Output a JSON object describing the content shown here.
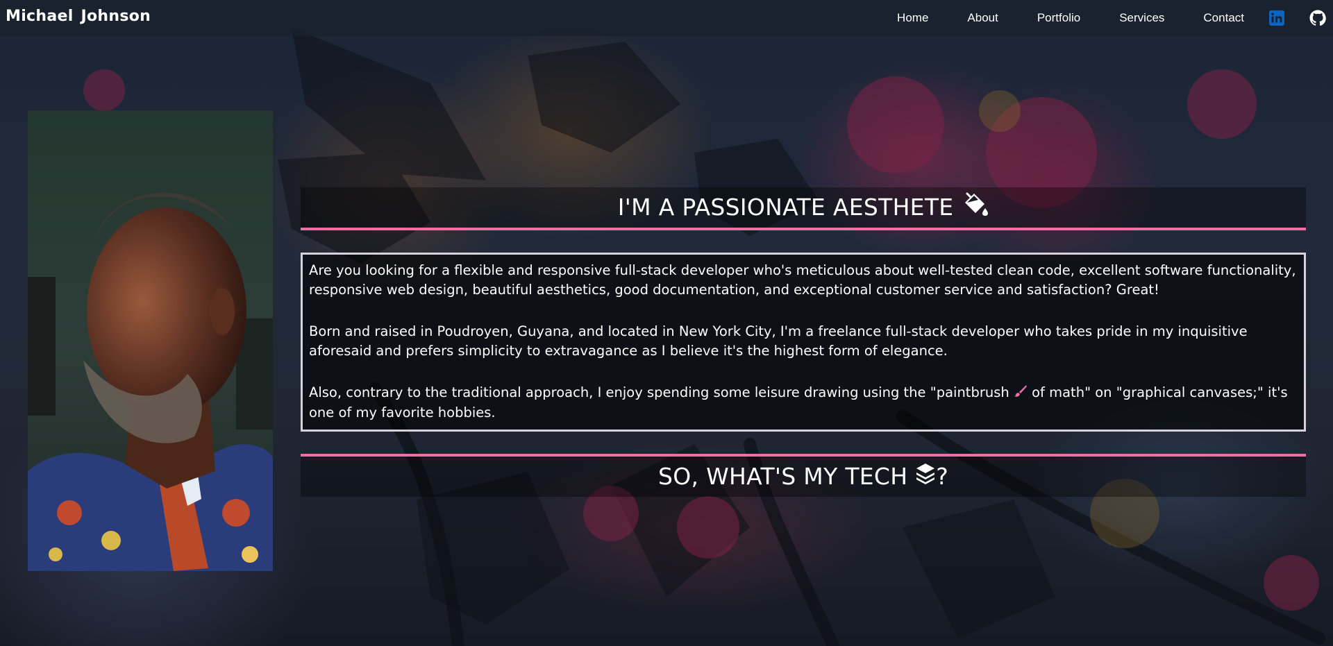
{
  "nav": {
    "brand": "Michael  Johnson",
    "links": [
      "Home",
      "About",
      "Portfolio",
      "Services",
      "Contact"
    ],
    "social_icons": [
      "linkedin-icon",
      "github-icon"
    ]
  },
  "portrait": {
    "alt": "Portrait of Michael Johnson"
  },
  "about": {
    "heading": "I'M A PASSIONATE AESTHETE",
    "heading_icon": "fill-drip-icon",
    "paragraphs": [
      "Are you looking for a flexible and responsive full-stack developer who's meticulous about well-tested clean code, excellent software functionality, responsive web design, beautiful aesthetics, good documentation, and exceptional customer service and satisfaction? Great!",
      "Born and raised in Poudroyen, Guyana, and located in New York City, I'm a freelance full-stack developer who takes pride in my inquisitive aforesaid and prefers simplicity to extravagance as I believe it's the highest form of elegance."
    ],
    "paragraph3_before": "Also, contrary to the traditional approach, I enjoy spending some leisure drawing using the \"paintbrush ",
    "paragraph3_after": " of math\" on \"graphical canvases;\" it's one of my favorite hobbies.",
    "paintbrush_icon": "paintbrush-icon"
  },
  "tech": {
    "heading_before": "SO, WHAT'S MY TECH ",
    "heading_after": "?",
    "heading_icon": "layer-group-icon"
  },
  "colors": {
    "accent_pink": "#ef6fa3",
    "linkedin_blue": "#0a66c2",
    "box_border": "#d7d2dc"
  }
}
